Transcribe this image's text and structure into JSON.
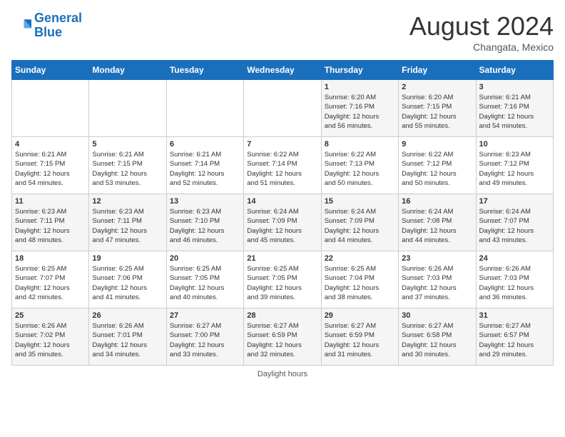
{
  "header": {
    "logo_line1": "General",
    "logo_line2": "Blue",
    "month_title": "August 2024",
    "subtitle": "Changata, Mexico"
  },
  "footer": {
    "daylight_label": "Daylight hours"
  },
  "days_of_week": [
    "Sunday",
    "Monday",
    "Tuesday",
    "Wednesday",
    "Thursday",
    "Friday",
    "Saturday"
  ],
  "weeks": [
    [
      {
        "day": "",
        "info": ""
      },
      {
        "day": "",
        "info": ""
      },
      {
        "day": "",
        "info": ""
      },
      {
        "day": "",
        "info": ""
      },
      {
        "day": "1",
        "info": "Sunrise: 6:20 AM\nSunset: 7:16 PM\nDaylight: 12 hours\nand 56 minutes."
      },
      {
        "day": "2",
        "info": "Sunrise: 6:20 AM\nSunset: 7:15 PM\nDaylight: 12 hours\nand 55 minutes."
      },
      {
        "day": "3",
        "info": "Sunrise: 6:21 AM\nSunset: 7:16 PM\nDaylight: 12 hours\nand 54 minutes."
      }
    ],
    [
      {
        "day": "4",
        "info": "Sunrise: 6:21 AM\nSunset: 7:15 PM\nDaylight: 12 hours\nand 54 minutes."
      },
      {
        "day": "5",
        "info": "Sunrise: 6:21 AM\nSunset: 7:15 PM\nDaylight: 12 hours\nand 53 minutes."
      },
      {
        "day": "6",
        "info": "Sunrise: 6:21 AM\nSunset: 7:14 PM\nDaylight: 12 hours\nand 52 minutes."
      },
      {
        "day": "7",
        "info": "Sunrise: 6:22 AM\nSunset: 7:14 PM\nDaylight: 12 hours\nand 51 minutes."
      },
      {
        "day": "8",
        "info": "Sunrise: 6:22 AM\nSunset: 7:13 PM\nDaylight: 12 hours\nand 50 minutes."
      },
      {
        "day": "9",
        "info": "Sunrise: 6:22 AM\nSunset: 7:12 PM\nDaylight: 12 hours\nand 50 minutes."
      },
      {
        "day": "10",
        "info": "Sunrise: 6:23 AM\nSunset: 7:12 PM\nDaylight: 12 hours\nand 49 minutes."
      }
    ],
    [
      {
        "day": "11",
        "info": "Sunrise: 6:23 AM\nSunset: 7:11 PM\nDaylight: 12 hours\nand 48 minutes."
      },
      {
        "day": "12",
        "info": "Sunrise: 6:23 AM\nSunset: 7:11 PM\nDaylight: 12 hours\nand 47 minutes."
      },
      {
        "day": "13",
        "info": "Sunrise: 6:23 AM\nSunset: 7:10 PM\nDaylight: 12 hours\nand 46 minutes."
      },
      {
        "day": "14",
        "info": "Sunrise: 6:24 AM\nSunset: 7:09 PM\nDaylight: 12 hours\nand 45 minutes."
      },
      {
        "day": "15",
        "info": "Sunrise: 6:24 AM\nSunset: 7:09 PM\nDaylight: 12 hours\nand 44 minutes."
      },
      {
        "day": "16",
        "info": "Sunrise: 6:24 AM\nSunset: 7:08 PM\nDaylight: 12 hours\nand 44 minutes."
      },
      {
        "day": "17",
        "info": "Sunrise: 6:24 AM\nSunset: 7:07 PM\nDaylight: 12 hours\nand 43 minutes."
      }
    ],
    [
      {
        "day": "18",
        "info": "Sunrise: 6:25 AM\nSunset: 7:07 PM\nDaylight: 12 hours\nand 42 minutes."
      },
      {
        "day": "19",
        "info": "Sunrise: 6:25 AM\nSunset: 7:06 PM\nDaylight: 12 hours\nand 41 minutes."
      },
      {
        "day": "20",
        "info": "Sunrise: 6:25 AM\nSunset: 7:05 PM\nDaylight: 12 hours\nand 40 minutes."
      },
      {
        "day": "21",
        "info": "Sunrise: 6:25 AM\nSunset: 7:05 PM\nDaylight: 12 hours\nand 39 minutes."
      },
      {
        "day": "22",
        "info": "Sunrise: 6:25 AM\nSunset: 7:04 PM\nDaylight: 12 hours\nand 38 minutes."
      },
      {
        "day": "23",
        "info": "Sunrise: 6:26 AM\nSunset: 7:03 PM\nDaylight: 12 hours\nand 37 minutes."
      },
      {
        "day": "24",
        "info": "Sunrise: 6:26 AM\nSunset: 7:03 PM\nDaylight: 12 hours\nand 36 minutes."
      }
    ],
    [
      {
        "day": "25",
        "info": "Sunrise: 6:26 AM\nSunset: 7:02 PM\nDaylight: 12 hours\nand 35 minutes."
      },
      {
        "day": "26",
        "info": "Sunrise: 6:26 AM\nSunset: 7:01 PM\nDaylight: 12 hours\nand 34 minutes."
      },
      {
        "day": "27",
        "info": "Sunrise: 6:27 AM\nSunset: 7:00 PM\nDaylight: 12 hours\nand 33 minutes."
      },
      {
        "day": "28",
        "info": "Sunrise: 6:27 AM\nSunset: 6:59 PM\nDaylight: 12 hours\nand 32 minutes."
      },
      {
        "day": "29",
        "info": "Sunrise: 6:27 AM\nSunset: 6:59 PM\nDaylight: 12 hours\nand 31 minutes."
      },
      {
        "day": "30",
        "info": "Sunrise: 6:27 AM\nSunset: 6:58 PM\nDaylight: 12 hours\nand 30 minutes."
      },
      {
        "day": "31",
        "info": "Sunrise: 6:27 AM\nSunset: 6:57 PM\nDaylight: 12 hours\nand 29 minutes."
      }
    ]
  ]
}
